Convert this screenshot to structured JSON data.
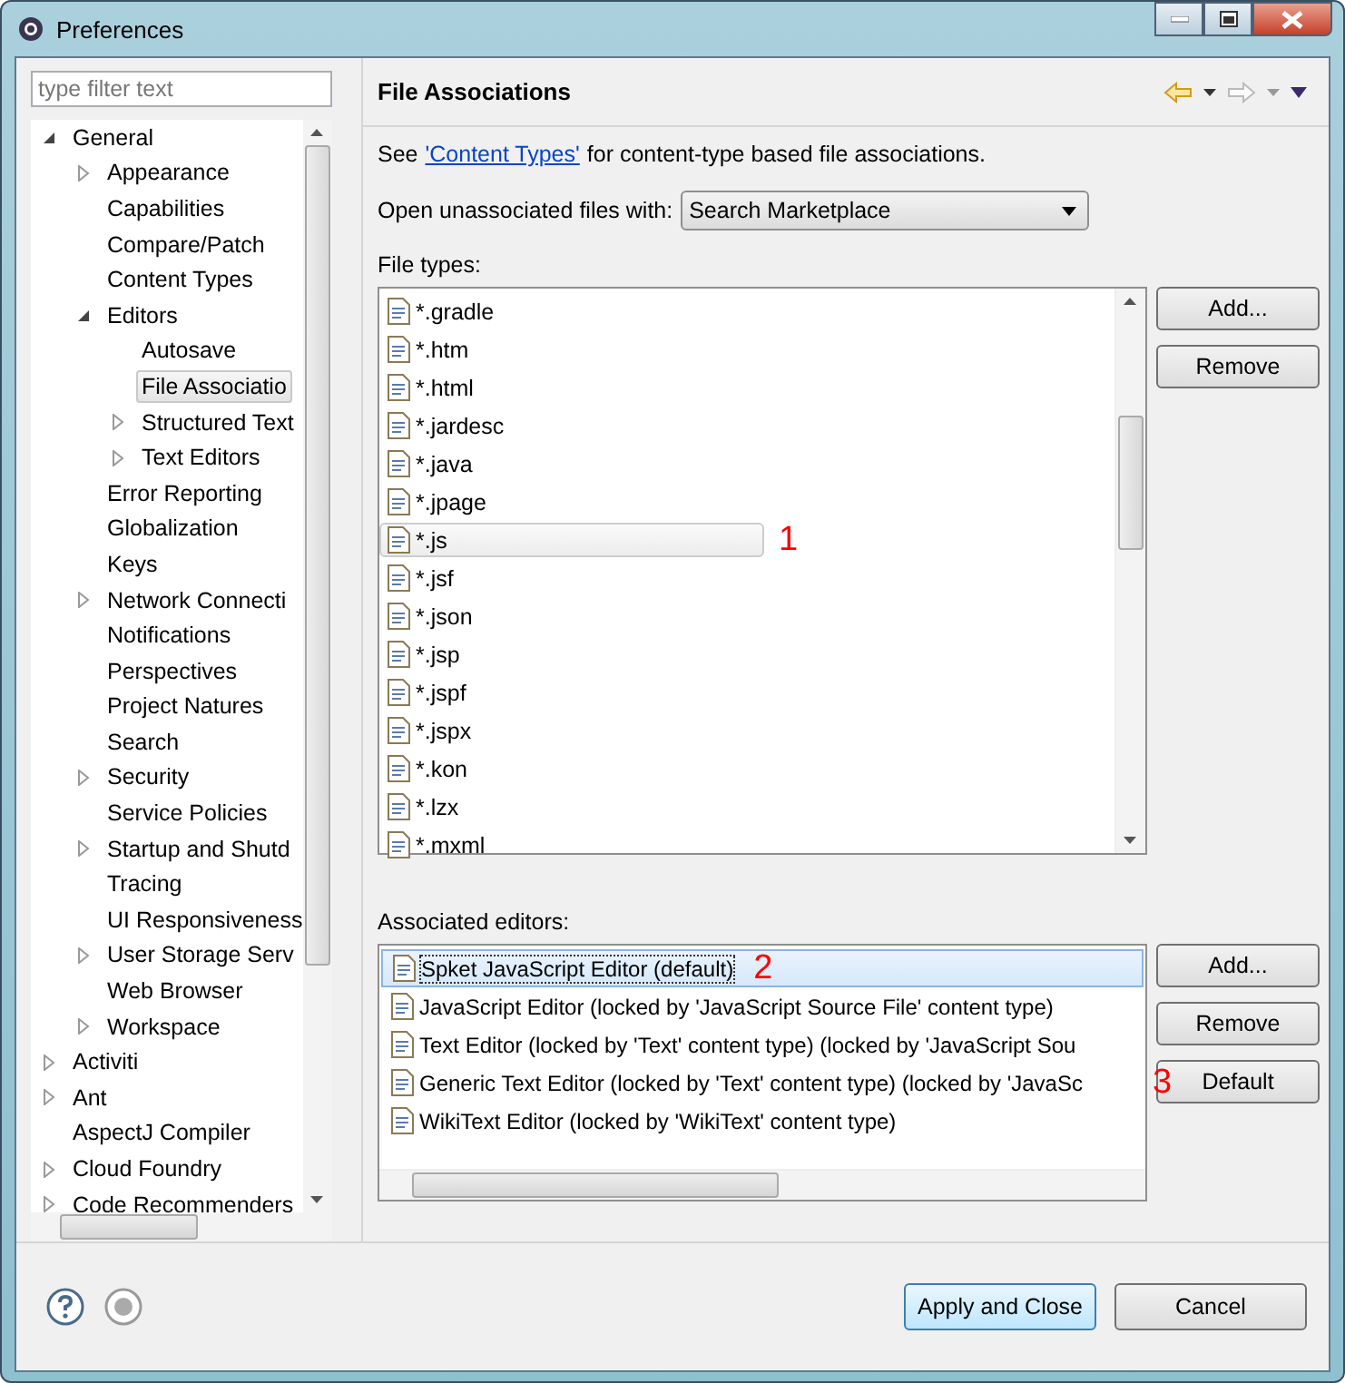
{
  "window": {
    "title": "Preferences"
  },
  "filter": {
    "placeholder": "type filter text"
  },
  "tree": [
    {
      "label": "General",
      "expanded": true,
      "selected": false,
      "children": [
        {
          "label": "Appearance",
          "expanded": false,
          "selected": false
        },
        {
          "label": "Capabilities",
          "selected": false
        },
        {
          "label": "Compare/Patch",
          "selected": false
        },
        {
          "label": "Content Types",
          "selected": false
        },
        {
          "label": "Editors",
          "expanded": true,
          "selected": false,
          "children": [
            {
              "label": "Autosave",
              "selected": false
            },
            {
              "label": "File Associatio",
              "selected": true
            },
            {
              "label": "Structured Text",
              "expanded": false,
              "selected": false
            },
            {
              "label": "Text Editors",
              "expanded": false,
              "selected": false
            }
          ]
        },
        {
          "label": "Error Reporting",
          "selected": false
        },
        {
          "label": "Globalization",
          "selected": false
        },
        {
          "label": "Keys",
          "selected": false
        },
        {
          "label": "Network Connecti",
          "expanded": false,
          "selected": false
        },
        {
          "label": "Notifications",
          "selected": false
        },
        {
          "label": "Perspectives",
          "selected": false
        },
        {
          "label": "Project Natures",
          "selected": false
        },
        {
          "label": "Search",
          "selected": false
        },
        {
          "label": "Security",
          "expanded": false,
          "selected": false
        },
        {
          "label": "Service Policies",
          "selected": false
        },
        {
          "label": "Startup and Shutd",
          "expanded": false,
          "selected": false
        },
        {
          "label": "Tracing",
          "selected": false
        },
        {
          "label": "UI Responsiveness",
          "selected": false
        },
        {
          "label": "User Storage Serv",
          "expanded": false,
          "selected": false
        },
        {
          "label": "Web Browser",
          "selected": false
        },
        {
          "label": "Workspace",
          "expanded": false,
          "selected": false
        }
      ]
    },
    {
      "label": "Activiti",
      "expanded": false,
      "selected": false
    },
    {
      "label": "Ant",
      "expanded": false,
      "selected": false
    },
    {
      "label": "AspectJ Compiler",
      "selected": false
    },
    {
      "label": "Cloud Foundry",
      "expanded": false,
      "selected": false
    },
    {
      "label": "Code Recommenders",
      "expanded": false,
      "selected": false
    }
  ],
  "page": {
    "title": "File Associations",
    "intro": {
      "before": "See",
      "link": "'Content Types'",
      "after": "for content-type based file associations."
    },
    "open_with": {
      "label": "Open unassociated files with:",
      "value": "Search Marketplace"
    },
    "file_types": {
      "label": "File types:",
      "items": [
        {
          "label": "*.gradle",
          "selected": false
        },
        {
          "label": "*.htm",
          "selected": false
        },
        {
          "label": "*.html",
          "selected": false
        },
        {
          "label": "*.jardesc",
          "selected": false
        },
        {
          "label": "*.java",
          "selected": false
        },
        {
          "label": "*.jpage",
          "selected": false
        },
        {
          "label": "*.js",
          "selected": true,
          "annotation": "1"
        },
        {
          "label": "*.jsf",
          "selected": false
        },
        {
          "label": "*.json",
          "selected": false
        },
        {
          "label": "*.jsp",
          "selected": false
        },
        {
          "label": "*.jspf",
          "selected": false
        },
        {
          "label": "*.jspx",
          "selected": false
        },
        {
          "label": "*.kon",
          "selected": false
        },
        {
          "label": "*.lzx",
          "selected": false
        },
        {
          "label": "*.mxml",
          "selected": false
        }
      ],
      "buttons": [
        {
          "label": "Add..."
        },
        {
          "label": "Remove"
        }
      ]
    },
    "editors": {
      "label": "Associated editors:",
      "items": [
        {
          "label": "Spket JavaScript Editor (default)",
          "selected": true,
          "annotation": "2"
        },
        {
          "label": "JavaScript Editor (locked by 'JavaScript Source File' content type)",
          "selected": false
        },
        {
          "label": "Text Editor (locked by 'Text' content type) (locked by 'JavaScript Sou",
          "selected": false
        },
        {
          "label": "Generic Text Editor (locked by 'Text' content type) (locked by 'JavaSc",
          "selected": false
        },
        {
          "label": "WikiText Editor (locked by 'WikiText' content type)",
          "selected": false
        }
      ],
      "buttons": [
        {
          "label": "Add..."
        },
        {
          "label": "Remove"
        },
        {
          "label": "Default",
          "annotation": "3"
        }
      ]
    }
  },
  "footer": {
    "buttons": [
      {
        "label": "Apply and Close",
        "default": true
      },
      {
        "label": "Cancel",
        "default": false
      }
    ]
  }
}
